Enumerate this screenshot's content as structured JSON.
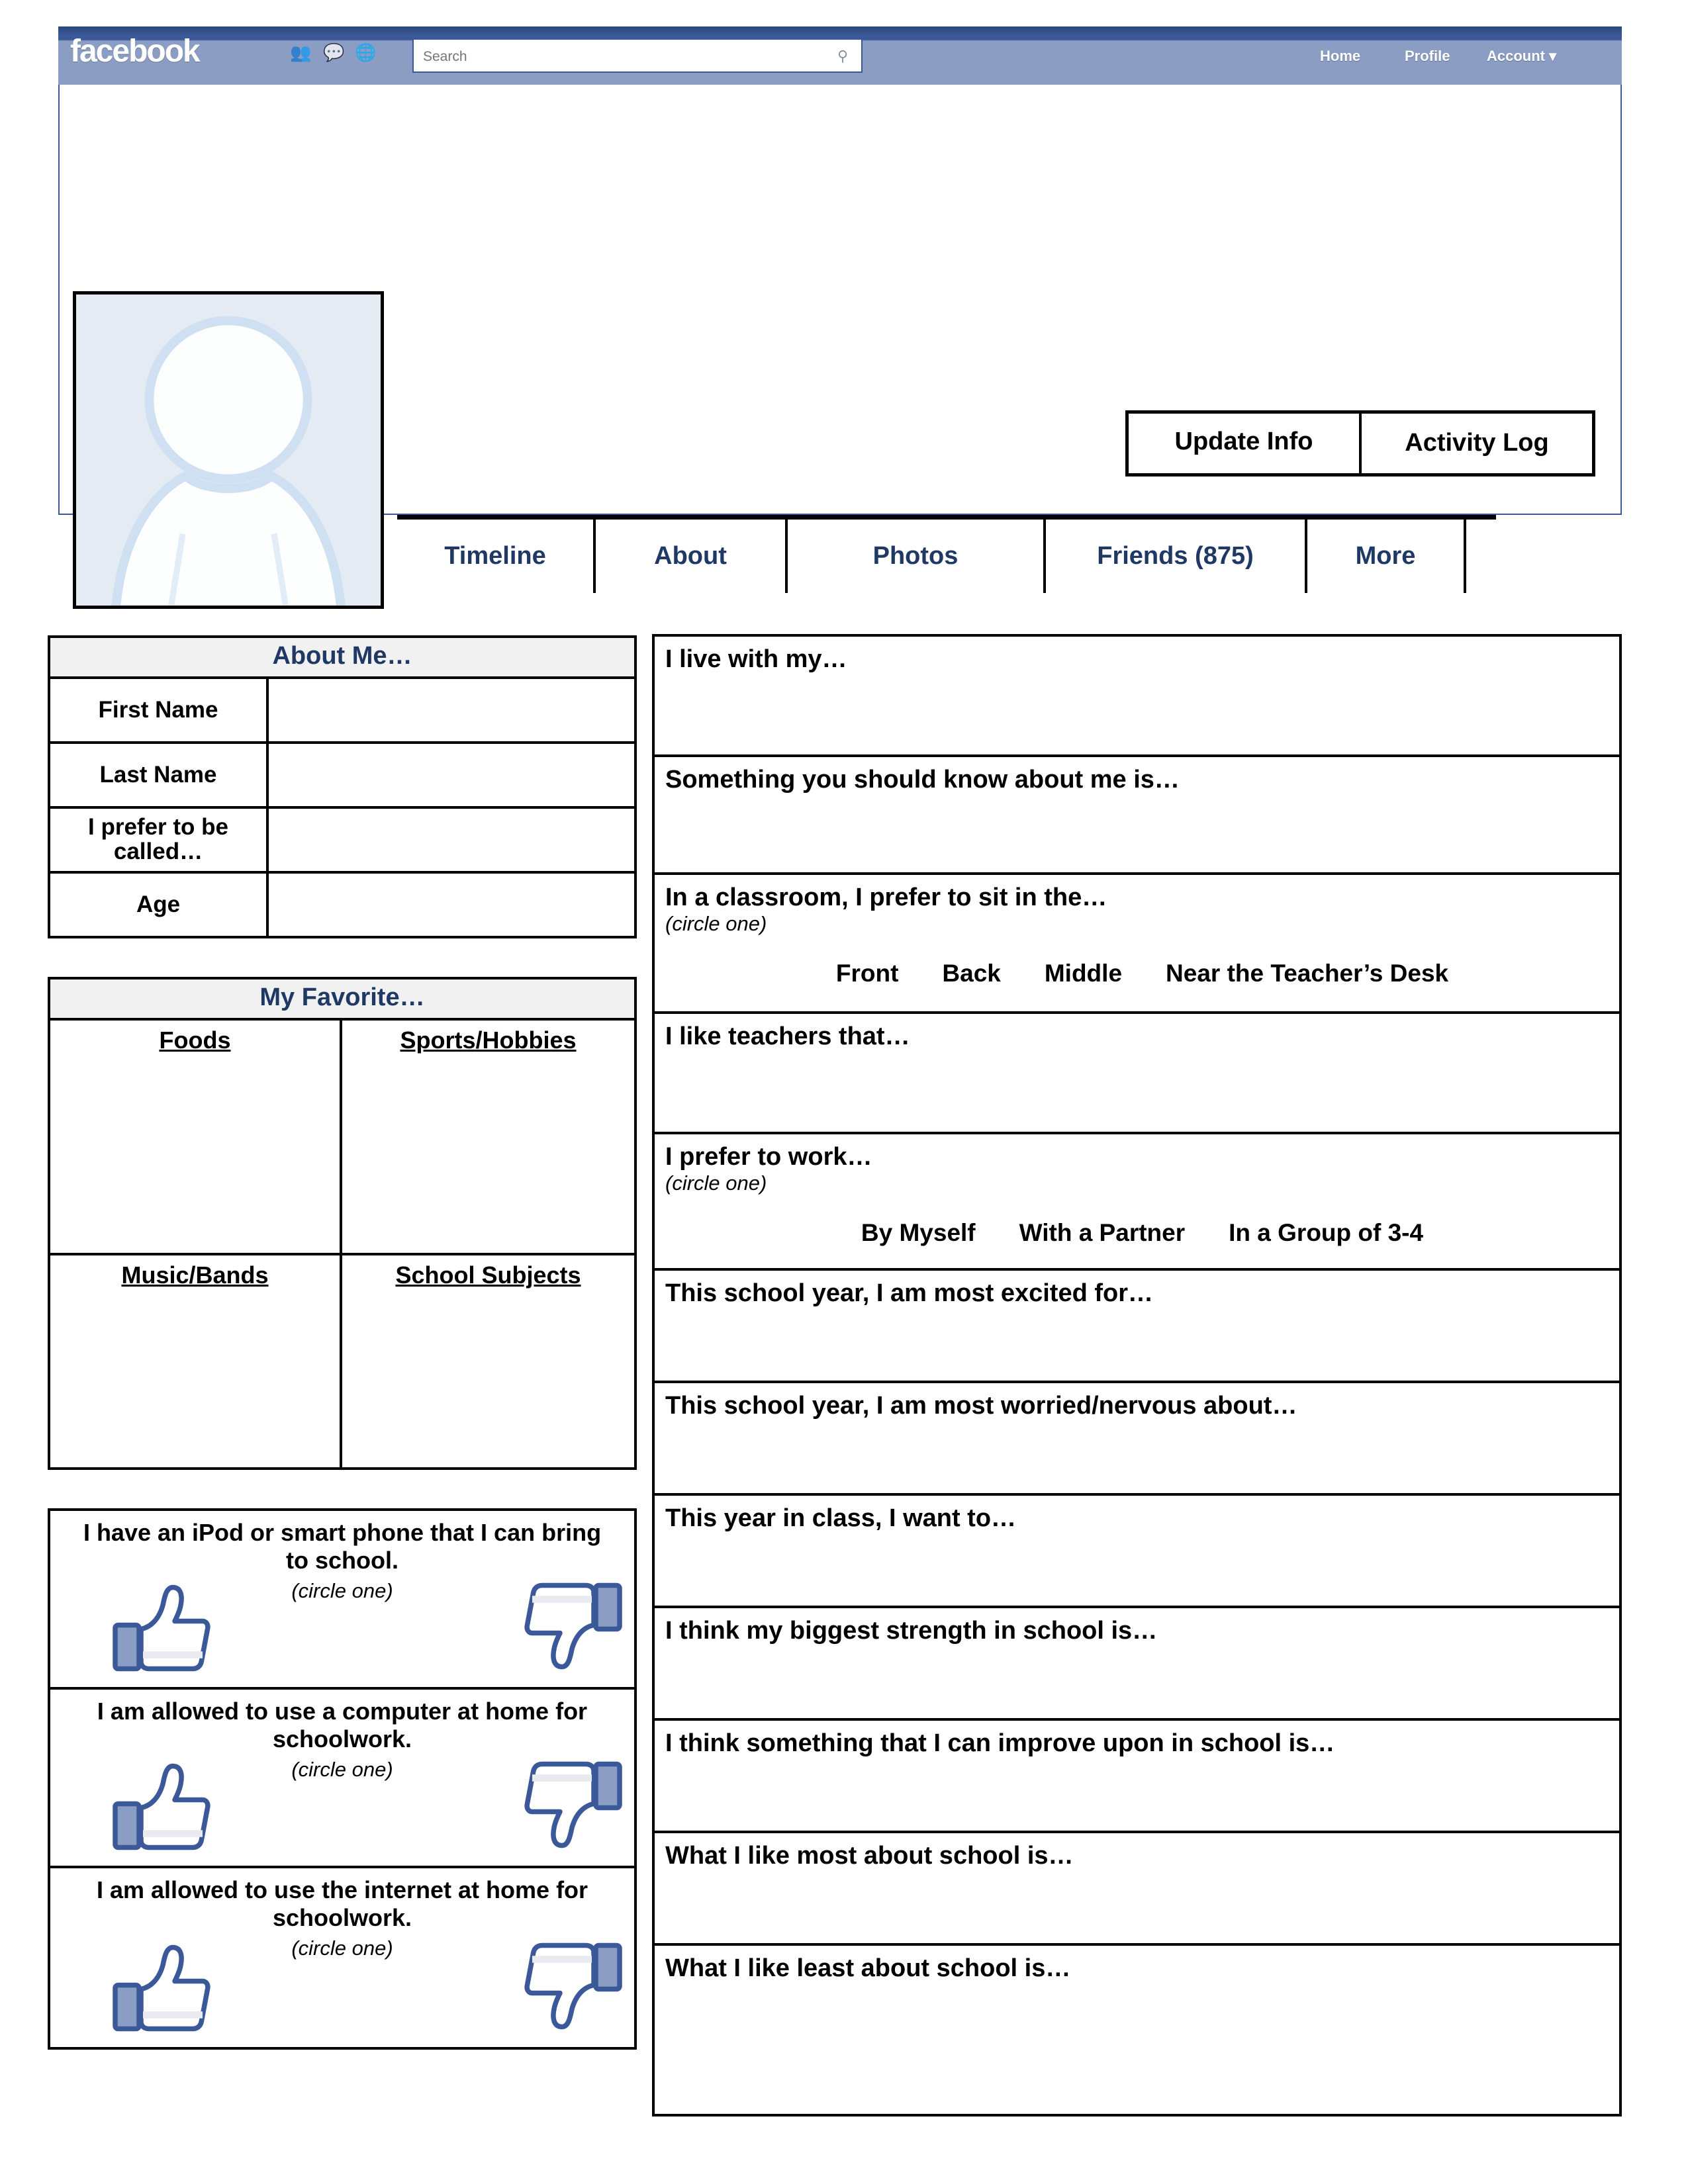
{
  "header": {
    "logo": "facebook",
    "icons": [
      "friends-icon",
      "messages-icon",
      "notifications-icon"
    ],
    "search_placeholder": "Search",
    "search_value": "",
    "search_icon": "magnifier-icon",
    "nav": {
      "home": "Home",
      "profile": "Profile",
      "account": "Account ▾"
    }
  },
  "profile": {
    "photo_alt": "default-avatar-silhouette",
    "buttons": {
      "update_info": "Update Info",
      "activity_log": "Activity Log"
    },
    "tabs": [
      {
        "label": "Timeline"
      },
      {
        "label": "About"
      },
      {
        "label": "Photos"
      },
      {
        "label": "Friends (875)"
      },
      {
        "label": "More"
      }
    ]
  },
  "about_me": {
    "heading": "About Me…",
    "rows": [
      {
        "label": "First Name",
        "value": ""
      },
      {
        "label": "Last Name",
        "value": ""
      },
      {
        "label": "I prefer to be called…",
        "value": ""
      },
      {
        "label": "Age",
        "value": ""
      }
    ]
  },
  "my_favorite": {
    "heading": "My Favorite…",
    "cells": [
      {
        "label": "Foods",
        "value": ""
      },
      {
        "label": "Sports/Hobbies",
        "value": ""
      },
      {
        "label": "Music/Bands",
        "value": ""
      },
      {
        "label": "School Subjects",
        "value": ""
      }
    ]
  },
  "like_questions": {
    "circle_one": "(circle one)",
    "items": [
      {
        "text": "I have an iPod or smart phone that I can bring to school."
      },
      {
        "text": "I am allowed to use a computer at home for schoolwork."
      },
      {
        "text": "I am allowed to use the internet at home for schoolwork."
      }
    ]
  },
  "prompts": [
    {
      "title": "I live with my…",
      "hint": "",
      "options": []
    },
    {
      "title": "Something you should know about me is…",
      "hint": "",
      "options": []
    },
    {
      "title": "In a classroom, I prefer to sit in the…",
      "hint": "(circle one)",
      "options": [
        "Front",
        "Back",
        "Middle",
        "Near the Teacher’s Desk"
      ]
    },
    {
      "title": "I like teachers that…",
      "hint": "",
      "options": []
    },
    {
      "title": "I prefer to work…",
      "hint": "(circle one)",
      "options": [
        "By Myself",
        "With a Partner",
        "In a Group of 3-4"
      ]
    },
    {
      "title": "This school year, I am most excited for…",
      "hint": "",
      "options": []
    },
    {
      "title": "This school year, I am most worried/nervous about…",
      "hint": "",
      "options": []
    },
    {
      "title": "This year in class, I want to…",
      "hint": "",
      "options": []
    },
    {
      "title": "I think my biggest strength in school is…",
      "hint": "",
      "options": []
    },
    {
      "title": "I think something that I can improve upon in school is…",
      "hint": "",
      "options": []
    },
    {
      "title": "What I like most about school is…",
      "hint": "",
      "options": []
    },
    {
      "title": "What I like least about school is…",
      "hint": "",
      "options": []
    }
  ],
  "colors": {
    "fb_blue_dark": "#3b5998",
    "fb_blue_light": "#8b9dc3",
    "heading_navy": "#1f3864",
    "panel_head_bg": "#f1f1f1",
    "avatar_bg": "#e4ebf3"
  }
}
